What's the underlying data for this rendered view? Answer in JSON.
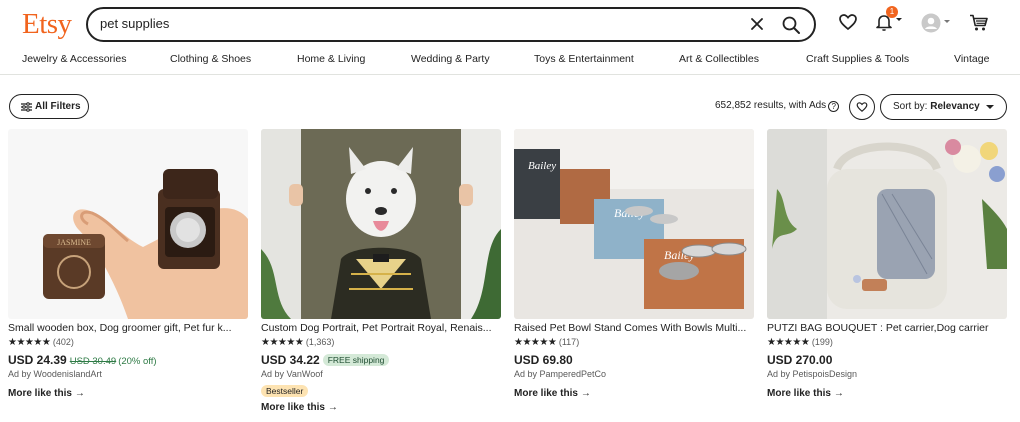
{
  "header": {
    "logo": "Etsy",
    "search_value": "pet supplies",
    "cart_badge": "1"
  },
  "nav": {
    "categories": [
      "Jewelry & Accessories",
      "Clothing & Shoes",
      "Home & Living",
      "Wedding & Party",
      "Toys & Entertainment",
      "Art & Collectibles",
      "Craft Supplies & Tools",
      "Vintage"
    ]
  },
  "toolbar": {
    "all_filters": "All Filters",
    "results": "652,852 results, with Ads",
    "help_glyph": "?",
    "sort_label": "Sort by:",
    "sort_value": "Relevancy"
  },
  "listings": [
    {
      "title": "Small wooden box, Dog groomer gift, Pet fur k...",
      "stars": "★★★★★",
      "reviews": "(402)",
      "price": "USD 24.39",
      "original_price": "USD 30.49",
      "discount": "(20% off)",
      "ad_by": "Ad by WoodenislandArt",
      "more_like_this": "More like this",
      "image_text": "JASMINE"
    },
    {
      "title": "Custom Dog Portrait, Pet Portrait Royal, Renais...",
      "stars": "★★★★★",
      "reviews": "(1,363)",
      "price": "USD 34.22",
      "shipping": "FREE shipping",
      "ad_by": "Ad by VanWoof",
      "badge": "Bestseller",
      "more_like_this": "More like this"
    },
    {
      "title": "Raised Pet Bowl Stand Comes With Bowls Multi...",
      "stars": "★★★★★",
      "reviews": "(117)",
      "price": "USD 69.80",
      "ad_by": "Ad by PamperedPetCo",
      "more_like_this": "More like this",
      "image_text": "Bailey"
    },
    {
      "title": "PUTZI BAG BOUQUET : Pet carrier,Dog carrier",
      "stars": "★★★★★",
      "reviews": "(199)",
      "price": "USD 270.00",
      "ad_by": "Ad by PetispoisDesign",
      "more_like_this": "More like this"
    }
  ],
  "colors": {
    "brand": "#f1641e",
    "sale_green": "#2f7b46",
    "free_shipping_bg": "#d4e9d7",
    "bestseller_bg": "#fde3b2"
  },
  "icons": [
    "close-icon",
    "search-icon",
    "heart-icon",
    "bell-icon",
    "avatar",
    "cart-icon",
    "filter-icon",
    "arrow-right-icon",
    "chevron-down-icon"
  ]
}
